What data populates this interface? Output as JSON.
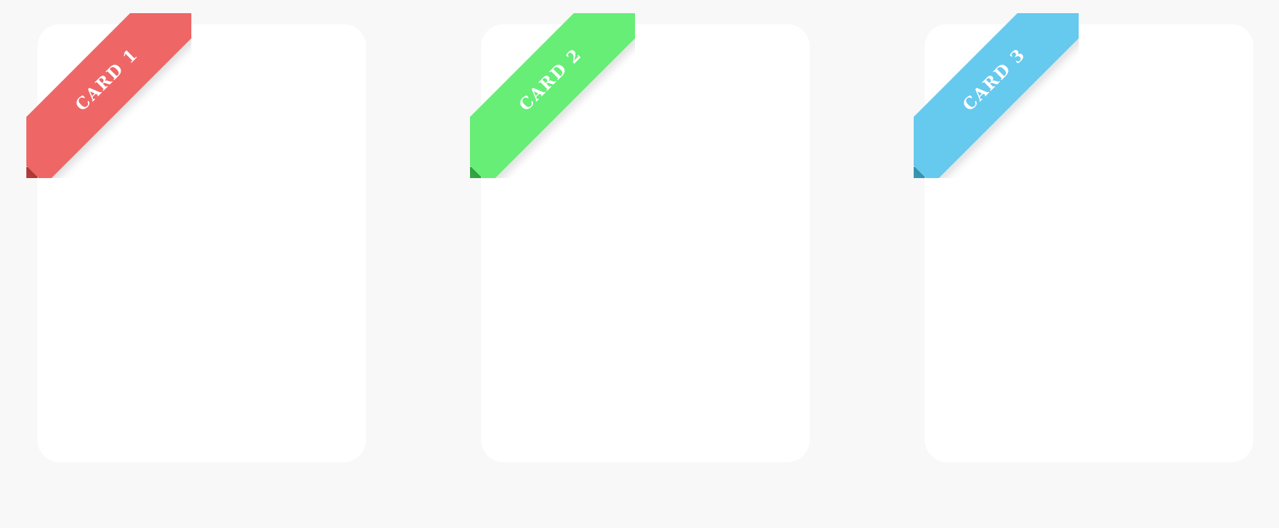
{
  "page": {
    "background": "#f8f8f8"
  },
  "cards": [
    {
      "ribbon_label": "CARD 1",
      "ribbon_color": "#ee6666",
      "ribbon_dark_color": "#b73a3a"
    },
    {
      "ribbon_label": "CARD 2",
      "ribbon_color": "#66ee77",
      "ribbon_dark_color": "#33a844"
    },
    {
      "ribbon_label": "CARD 3",
      "ribbon_color": "#66c9ee",
      "ribbon_dark_color": "#3a99b3"
    }
  ]
}
